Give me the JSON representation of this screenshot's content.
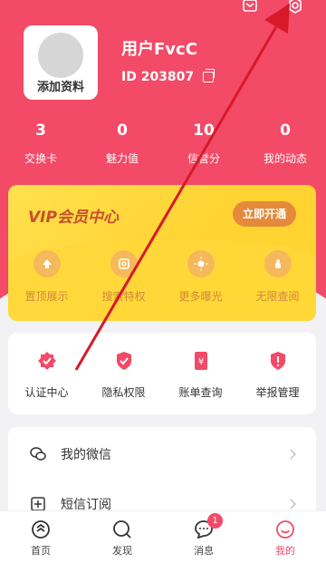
{
  "profile": {
    "avatar_label": "添加资料",
    "username": "用户FvcC",
    "id_text": "ID  203807"
  },
  "stats": [
    {
      "value": "3",
      "label": "交换卡"
    },
    {
      "value": "0",
      "label": "魅力值"
    },
    {
      "value": "10",
      "label": "信誉分"
    },
    {
      "value": "0",
      "label": "我的动态"
    }
  ],
  "vip": {
    "title": "VIP会员中心",
    "button": "立即开通",
    "features": [
      {
        "label": "置顶展示",
        "icon": "arrow-up-icon"
      },
      {
        "label": "搜索特权",
        "icon": "search-icon"
      },
      {
        "label": "更多曝光",
        "icon": "sun-icon"
      },
      {
        "label": "无限查阅",
        "icon": "hand-icon"
      }
    ]
  },
  "services": [
    {
      "label": "认证中心",
      "icon": "verified-badge-icon"
    },
    {
      "label": "隐私权限",
      "icon": "shield-check-icon"
    },
    {
      "label": "账单查询",
      "icon": "bill-icon"
    },
    {
      "label": "举报管理",
      "icon": "report-shield-icon"
    }
  ],
  "menu": [
    {
      "label": "我的微信",
      "icon": "wechat-icon"
    },
    {
      "label": "短信订阅",
      "icon": "sms-subscribe-icon"
    }
  ],
  "tabs": [
    {
      "label": "首页",
      "icon": "home-icon"
    },
    {
      "label": "发现",
      "icon": "discover-icon"
    },
    {
      "label": "消息",
      "icon": "message-icon",
      "badge": "1"
    },
    {
      "label": "我的",
      "icon": "profile-smile-icon"
    }
  ],
  "colors": {
    "accent": "#f24a67",
    "vip_text": "#c9502c",
    "vip_button": "#e58a3b"
  }
}
